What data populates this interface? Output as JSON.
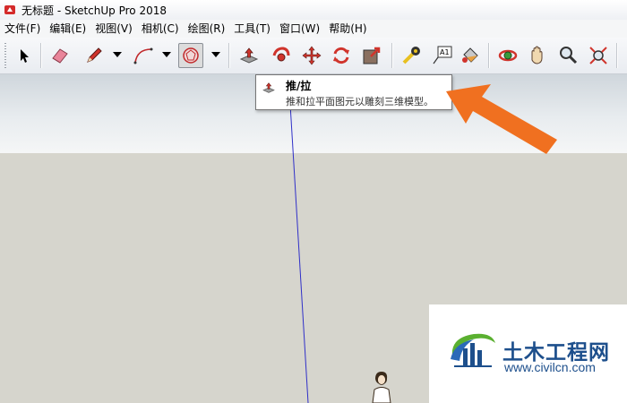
{
  "window": {
    "title": "无标题 - SketchUp Pro 2018"
  },
  "menubar": {
    "items": [
      "文件(F)",
      "编辑(E)",
      "视图(V)",
      "相机(C)",
      "绘图(R)",
      "工具(T)",
      "窗口(W)",
      "帮助(H)"
    ]
  },
  "toolbar": {
    "buttons": [
      {
        "name": "select",
        "icon": "arrow-cursor-icon"
      },
      {
        "name": "eraser",
        "icon": "eraser-icon"
      },
      {
        "name": "line",
        "icon": "pencil-icon"
      },
      {
        "name": "arc",
        "icon": "arc-icon"
      },
      {
        "name": "shape",
        "icon": "polygon-icon",
        "active": true
      },
      {
        "name": "push-pull",
        "icon": "push-pull-icon"
      },
      {
        "name": "follow-me",
        "icon": "follow-me-icon"
      },
      {
        "name": "move",
        "icon": "move-icon"
      },
      {
        "name": "rotate",
        "icon": "rotate-icon"
      },
      {
        "name": "scale",
        "icon": "scale-icon"
      },
      {
        "name": "tape-measure",
        "icon": "tape-measure-icon"
      },
      {
        "name": "text",
        "icon": "text-label-icon"
      },
      {
        "name": "paint-bucket",
        "icon": "paint-bucket-icon"
      },
      {
        "name": "orbit",
        "icon": "orbit-icon"
      },
      {
        "name": "pan",
        "icon": "hand-icon"
      },
      {
        "name": "zoom",
        "icon": "magnifier-icon"
      },
      {
        "name": "zoom-extents",
        "icon": "zoom-extents-icon"
      }
    ],
    "text_icon_label": "A1"
  },
  "tooltip": {
    "title": "推/拉",
    "description": "推和拉平面图元以雕刻三维模型。"
  },
  "watermark": {
    "name": "土木工程网",
    "url": "www.civilcn.com"
  },
  "colors": {
    "annotation_arrow": "#f07020",
    "ground": "#d6d5cd",
    "sky": "#e8ecef",
    "axis_blue": "#3030c8",
    "watermark_blue": "#1d4f8c"
  }
}
